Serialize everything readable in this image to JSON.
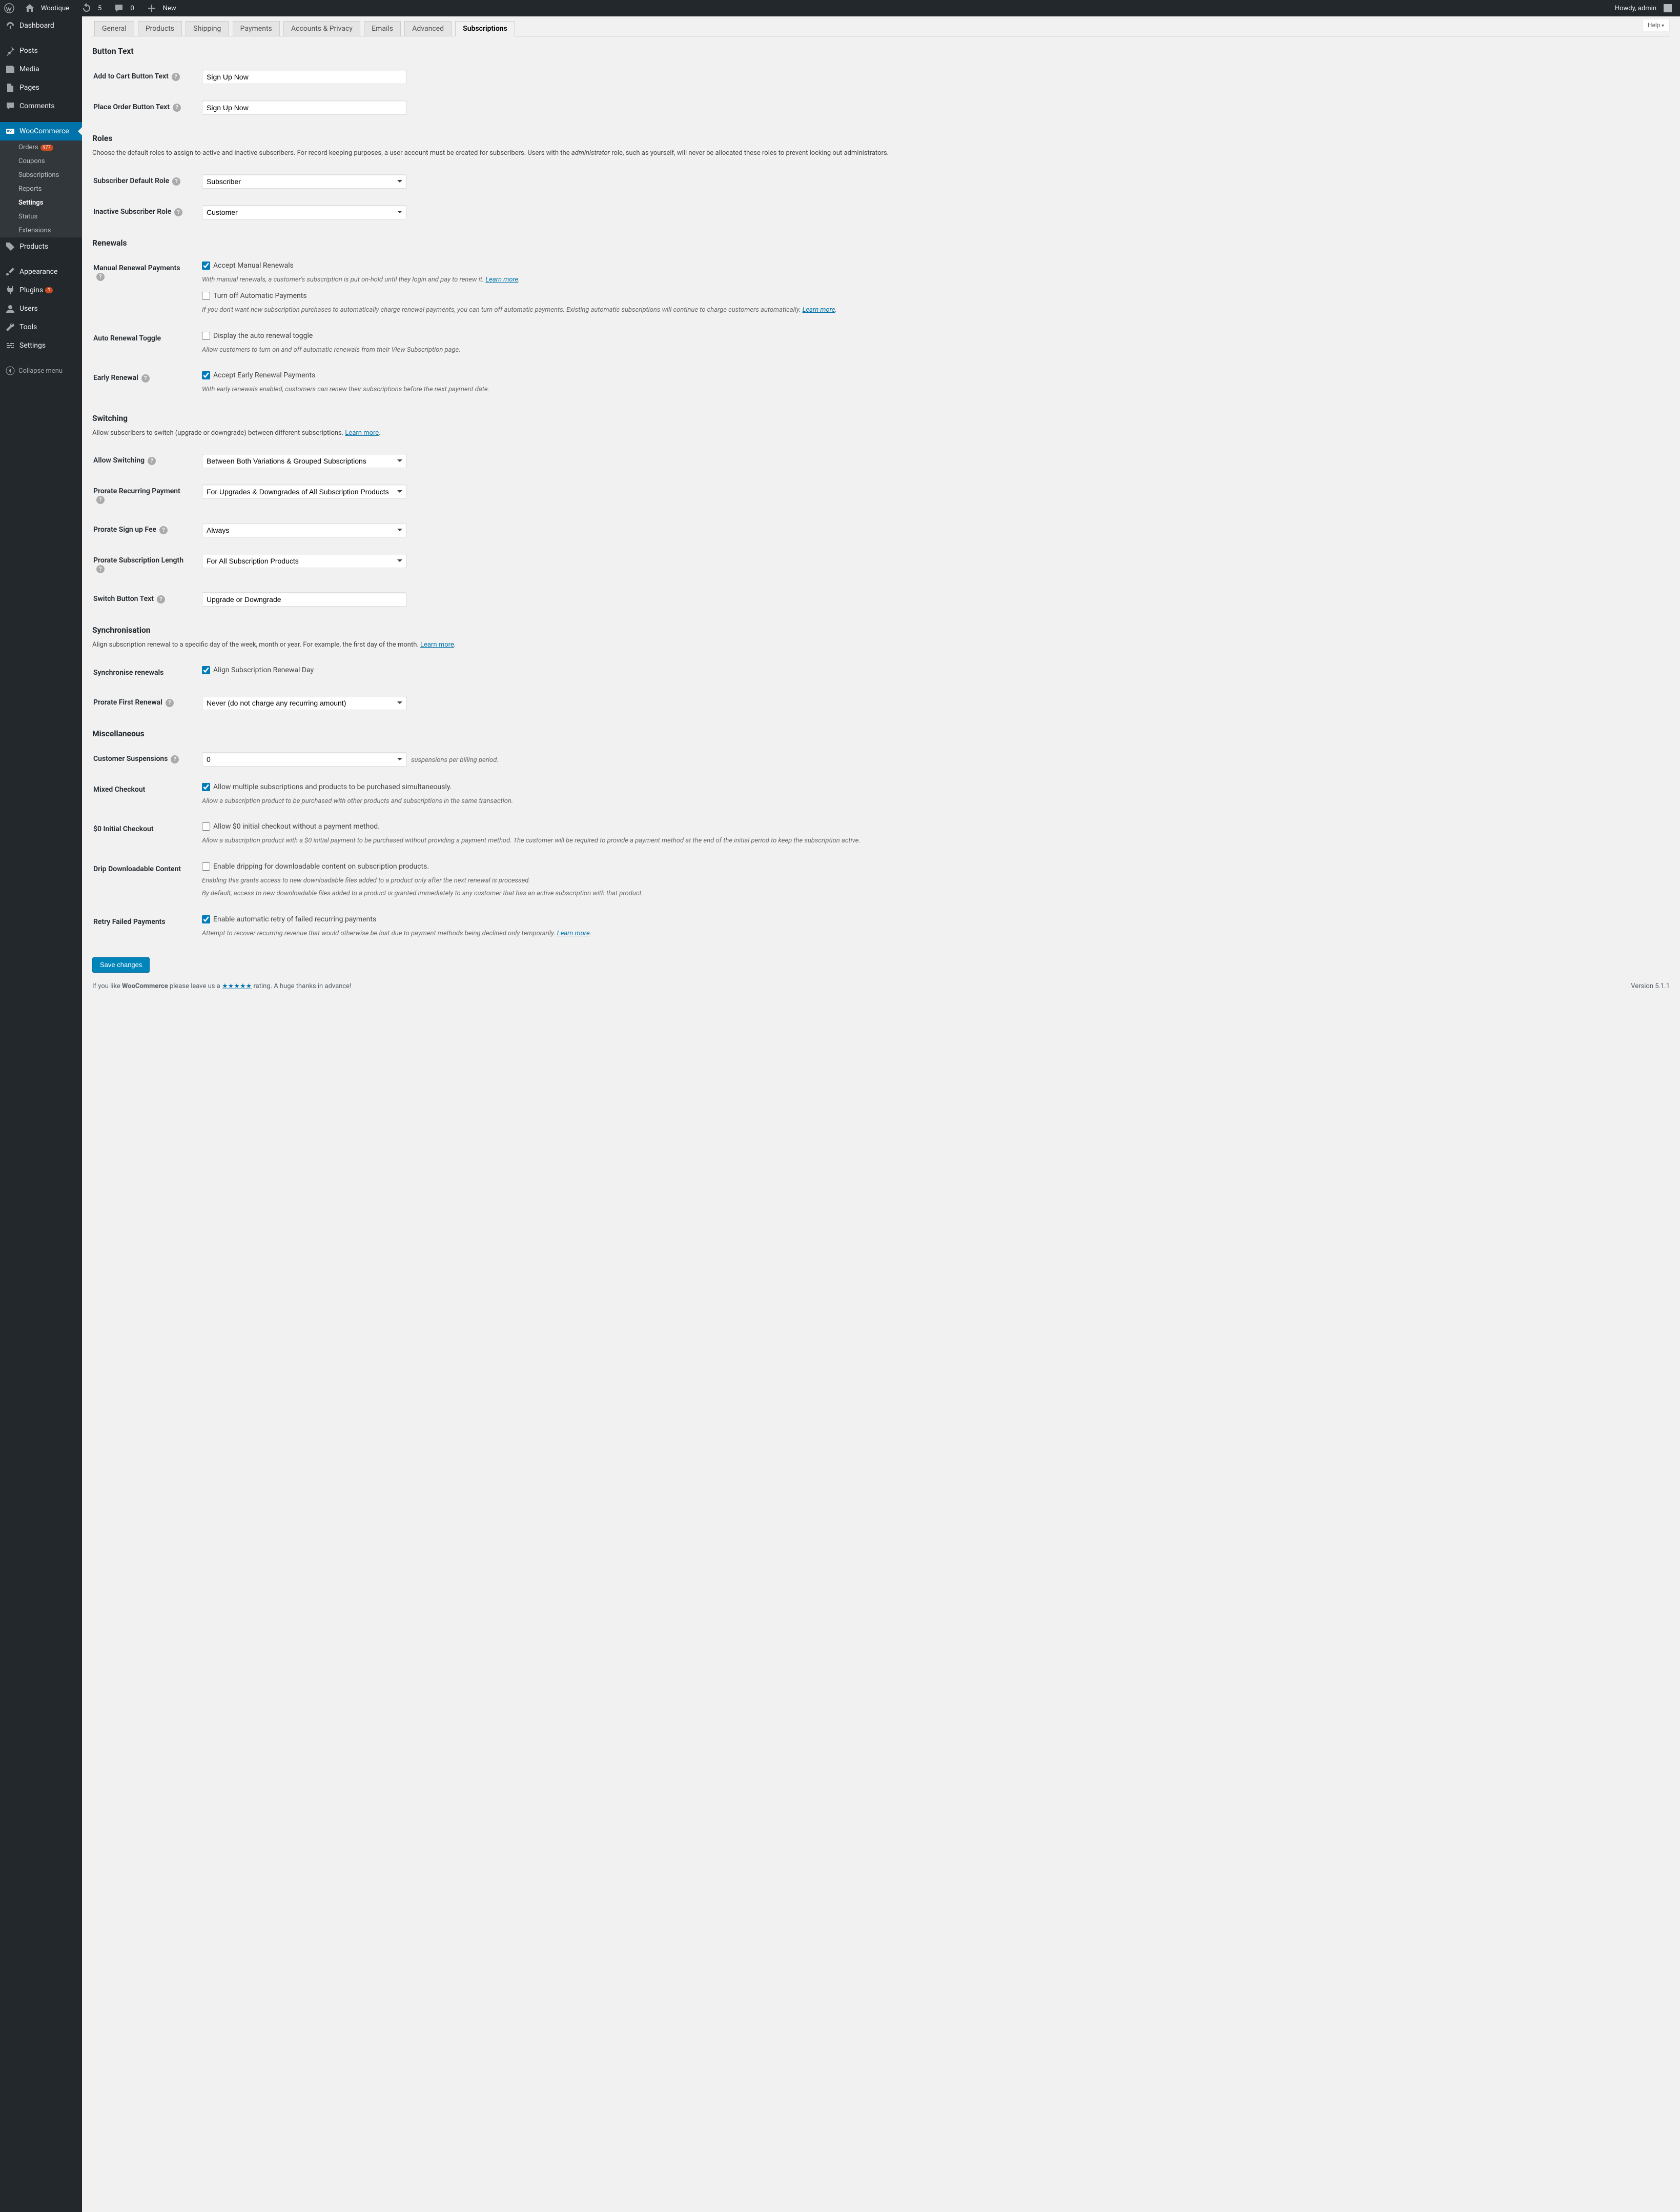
{
  "adminbar": {
    "site": "Wootique",
    "updates": "5",
    "comments": "0",
    "new": "New",
    "howdy": "Howdy, admin"
  },
  "menu": {
    "dashboard": "Dashboard",
    "posts": "Posts",
    "media": "Media",
    "pages": "Pages",
    "comments_m": "Comments",
    "woocommerce": "WooCommerce",
    "wc_badge": "977",
    "products": "Products",
    "appearance": "Appearance",
    "plugins": "Plugins",
    "plugins_badge": "1",
    "users": "Users",
    "tools": "Tools",
    "settings": "Settings",
    "collapse": "Collapse menu"
  },
  "submenu": {
    "orders": "Orders",
    "orders_badge": "977",
    "coupons": "Coupons",
    "subscriptions": "Subscriptions",
    "reports": "Reports",
    "settings": "Settings",
    "status": "Status",
    "extensions": "Extensions"
  },
  "screen": {
    "help": "Help"
  },
  "tabs": {
    "general": "General",
    "products": "Products",
    "shipping": "Shipping",
    "payments": "Payments",
    "accounts": "Accounts & Privacy",
    "emails": "Emails",
    "advanced": "Advanced",
    "subscriptions": "Subscriptions"
  },
  "sections": {
    "button_text": "Button Text",
    "roles": "Roles",
    "renewals": "Renewals",
    "switching": "Switching",
    "sync": "Synchronisation",
    "misc": "Miscellaneous"
  },
  "fields": {
    "add_to_cart_label": "Add to Cart Button Text",
    "add_to_cart_value": "Sign Up Now",
    "place_order_label": "Place Order Button Text",
    "place_order_value": "Sign Up Now",
    "roles_desc_pre": "Choose the default roles to assign to active and inactive subscribers. For record keeping purposes, a user account must be created for subscribers. Users with the ",
    "roles_desc_em": "administrator",
    "roles_desc_post": " role, such as yourself, will never be allocated these roles to prevent locking out administrators.",
    "subscriber_role_label": "Subscriber Default Role",
    "subscriber_role_value": "Subscriber",
    "inactive_role_label": "Inactive Subscriber Role",
    "inactive_role_value": "Customer",
    "manual_renewal_label": "Manual Renewal Payments",
    "accept_manual": "Accept Manual Renewals",
    "manual_desc": "With manual renewals, a customer's subscription is put on-hold until they login and pay to renew it. ",
    "turn_off_auto": "Turn off Automatic Payments",
    "turn_off_desc": "If you don't want new subscription purchases to automatically charge renewal payments, you can turn off automatic payments. Existing automatic subscriptions will continue to charge customers automatically. ",
    "learn_more": "Learn more",
    "auto_toggle_label": "Auto Renewal Toggle",
    "auto_toggle_chk": "Display the auto renewal toggle",
    "auto_toggle_desc": "Allow customers to turn on and off automatic renewals from their View Subscription page.",
    "early_renewal_label": "Early Renewal",
    "early_renewal_chk": "Accept Early Renewal Payments",
    "early_renewal_desc": "With early renewals enabled, customers can renew their subscriptions before the next payment date.",
    "switching_desc": "Allow subscribers to switch (upgrade or downgrade) between different subscriptions. ",
    "allow_switching_label": "Allow Switching",
    "allow_switching_value": "Between Both Variations & Grouped Subscriptions",
    "prorate_recurring_label": "Prorate Recurring Payment",
    "prorate_recurring_value": "For Upgrades & Downgrades of All Subscription Products",
    "prorate_signup_label": "Prorate Sign up Fee",
    "prorate_signup_value": "Always",
    "prorate_length_label": "Prorate Subscription Length",
    "prorate_length_value": "For All Subscription Products",
    "switch_button_label": "Switch Button Text",
    "switch_button_value": "Upgrade or Downgrade",
    "sync_desc": "Align subscription renewal to a specific day of the week, month or year. For example, the first day of the month. ",
    "sync_renewals_label": "Synchronise renewals",
    "sync_renewals_chk": "Align Subscription Renewal Day",
    "prorate_first_label": "Prorate First Renewal",
    "prorate_first_value": "Never (do not charge any recurring amount)",
    "cust_susp_label": "Customer Suspensions",
    "cust_susp_value": "0",
    "cust_susp_note": "suspensions per billing period.",
    "mixed_checkout_label": "Mixed Checkout",
    "mixed_checkout_chk": "Allow multiple subscriptions and products to be purchased simultaneously.",
    "mixed_checkout_desc": "Allow a subscription product to be purchased with other products and subscriptions in the same transaction.",
    "zero_initial_label": "$0 Initial Checkout",
    "zero_initial_chk": "Allow $0 initial checkout without a payment method.",
    "zero_initial_desc": "Allow a subscription product with a $0 initial payment to be purchased without providing a payment method. The customer will be required to provide a payment method at the end of the initial period to keep the subscription active.",
    "drip_label": "Drip Downloadable Content",
    "drip_chk": "Enable dripping for downloadable content on subscription products.",
    "drip_desc1": "Enabling this grants access to new downloadable files added to a product only after the next renewal is processed.",
    "drip_desc2": "By default, access to new downloadable files added to a product is granted immediately to any customer that has an active subscription with that product.",
    "retry_label": "Retry Failed Payments",
    "retry_chk": "Enable automatic retry of failed recurring payments",
    "retry_desc": "Attempt to recover recurring revenue that would otherwise be lost due to payment methods being declined only temporarily. "
  },
  "buttons": {
    "save": "Save changes"
  },
  "footer": {
    "left_pre": "If you like ",
    "left_wc": "WooCommerce",
    "left_mid": " please leave us a ",
    "stars": "★★★★★",
    "left_post": " rating. A huge thanks in advance!",
    "version": "Version 5.1.1"
  }
}
